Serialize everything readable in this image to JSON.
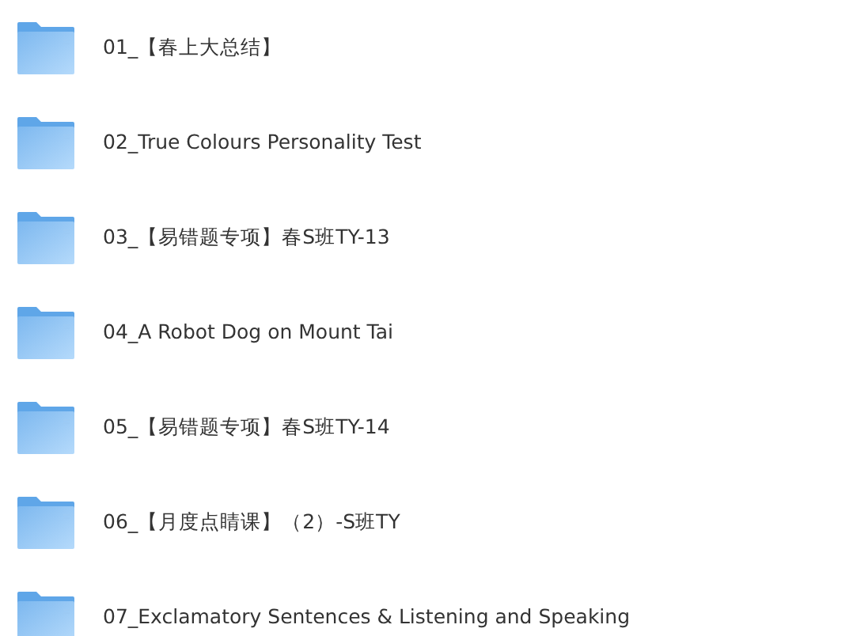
{
  "folders": [
    {
      "name": "01_【春上大总结】"
    },
    {
      "name": "02_True Colours Personality Test"
    },
    {
      "name": "03_【易错题专项】春S班TY-13"
    },
    {
      "name": "04_A Robot Dog on Mount Tai"
    },
    {
      "name": "05_【易错题专项】春S班TY-14"
    },
    {
      "name": "06_【月度点睛课】（2）-S班TY"
    },
    {
      "name": "07_Exclamatory Sentences & Listening and Speaking"
    }
  ]
}
